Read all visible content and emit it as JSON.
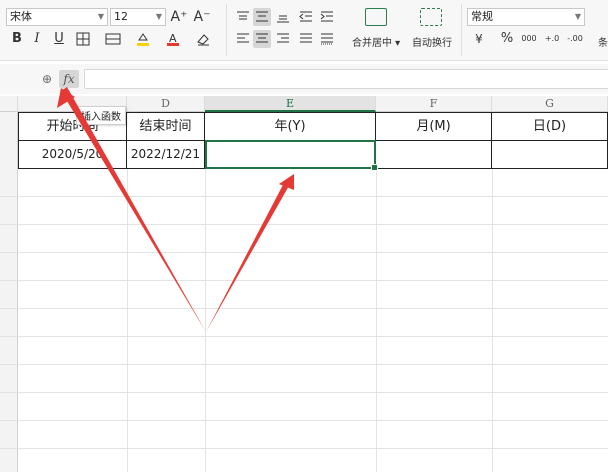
{
  "ribbon": {
    "font_name": "宋体",
    "font_size": "12",
    "grow_font": "A⁺",
    "shrink_font": "A⁻",
    "bold": "B",
    "italic": "I",
    "underline": "U",
    "merge_center_label": "合并居中",
    "wrap_text_label": "自动换行",
    "number_format": "常规",
    "currency_symbol": "¥",
    "percent_symbol": "%",
    "thousands_symbol": "000",
    "inc_decimal": "+.0",
    "dec_decimal": "-.00",
    "conditional_partial": "条"
  },
  "formula_bar": {
    "zoom_icon_text": "⊕",
    "fx_label": "fx",
    "value": ""
  },
  "tooltip": "插入函数",
  "columns": [
    "D",
    "E",
    "F",
    "G"
  ],
  "header_row": {
    "c": "开始时间",
    "d": "结束时间",
    "e": "年(Y)",
    "f": "月(M)",
    "g": "日(D)"
  },
  "data_row": {
    "c": "2020/5/20",
    "d": "2022/12/21",
    "e": "",
    "f": "",
    "g": ""
  },
  "colors": {
    "accent_green": "#217346",
    "arrow_red": "#e53935"
  }
}
